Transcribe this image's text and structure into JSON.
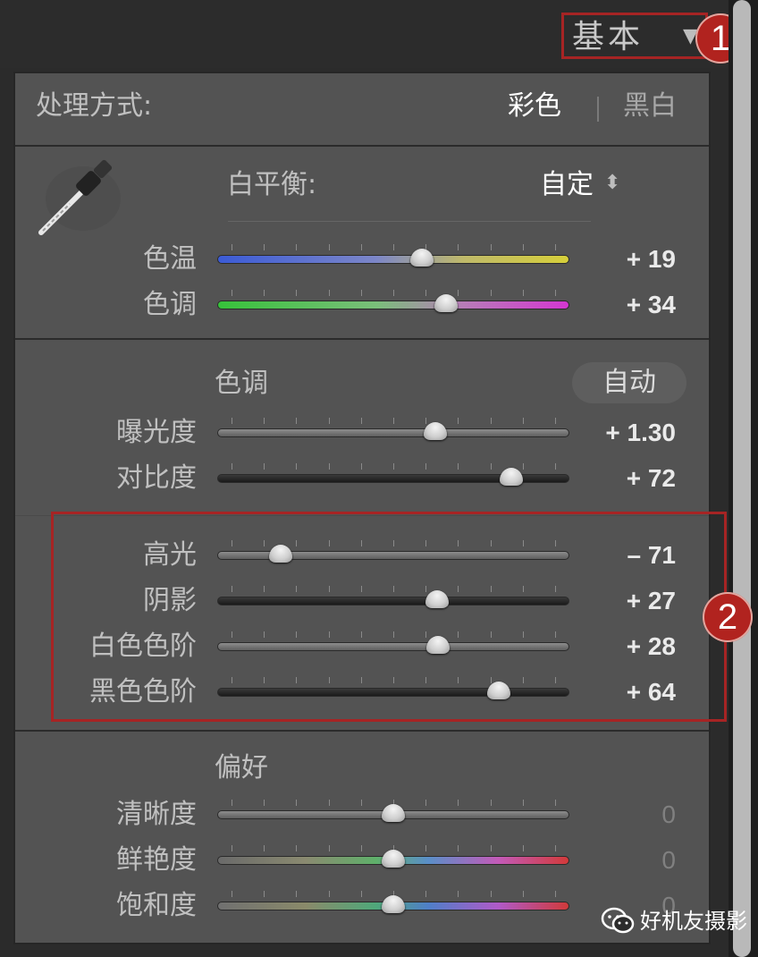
{
  "header": {
    "title": "基本",
    "collapse_icon": "triangle-down-icon"
  },
  "callouts": {
    "first": "1",
    "second": "2"
  },
  "treatment": {
    "label": "处理方式:",
    "color_option": "彩色",
    "bw_option": "黑白",
    "selected": "彩色"
  },
  "white_balance": {
    "label": "白平衡:",
    "mode": "自定",
    "mode_arrows": "⬍",
    "tool_icon": "eyedropper-icon",
    "sliders": [
      {
        "label": "色温",
        "value_text": "+ 19",
        "position": 0.58,
        "track": "temp"
      },
      {
        "label": "色调",
        "value_text": "+ 34",
        "position": 0.65,
        "track": "tint"
      }
    ]
  },
  "tone": {
    "label": "色调",
    "auto_label": "自动",
    "sliders": [
      {
        "label": "曝光度",
        "value_text": "+ 1.30",
        "position": 0.62,
        "track": "neutral"
      },
      {
        "label": "对比度",
        "value_text": "+ 72",
        "position": 0.835,
        "track": "dark"
      }
    ],
    "highlighted_sliders": [
      {
        "label": "高光",
        "value_text": "– 71",
        "position": 0.18,
        "track": "neutral"
      },
      {
        "label": "阴影",
        "value_text": "+ 27",
        "position": 0.625,
        "track": "dark"
      },
      {
        "label": "白色色阶",
        "value_text": "+ 28",
        "position": 0.628,
        "track": "neutral"
      },
      {
        "label": "黑色色阶",
        "value_text": "+ 64",
        "position": 0.8,
        "track": "dark"
      }
    ]
  },
  "presence": {
    "label": "偏好",
    "sliders": [
      {
        "label": "清晰度",
        "value_text": "0",
        "position": 0.5,
        "track": "neutral"
      },
      {
        "label": "鲜艳度",
        "value_text": "0",
        "position": 0.5,
        "track": "vibrance"
      },
      {
        "label": "饱和度",
        "value_text": "0",
        "position": 0.5,
        "track": "saturation"
      }
    ]
  },
  "watermark": {
    "text": "好机友摄影",
    "icon": "wechat-icon"
  },
  "colors": {
    "panel_bg": "#535353",
    "callout_red": "#a62424",
    "badge_red": "#b1231f"
  }
}
